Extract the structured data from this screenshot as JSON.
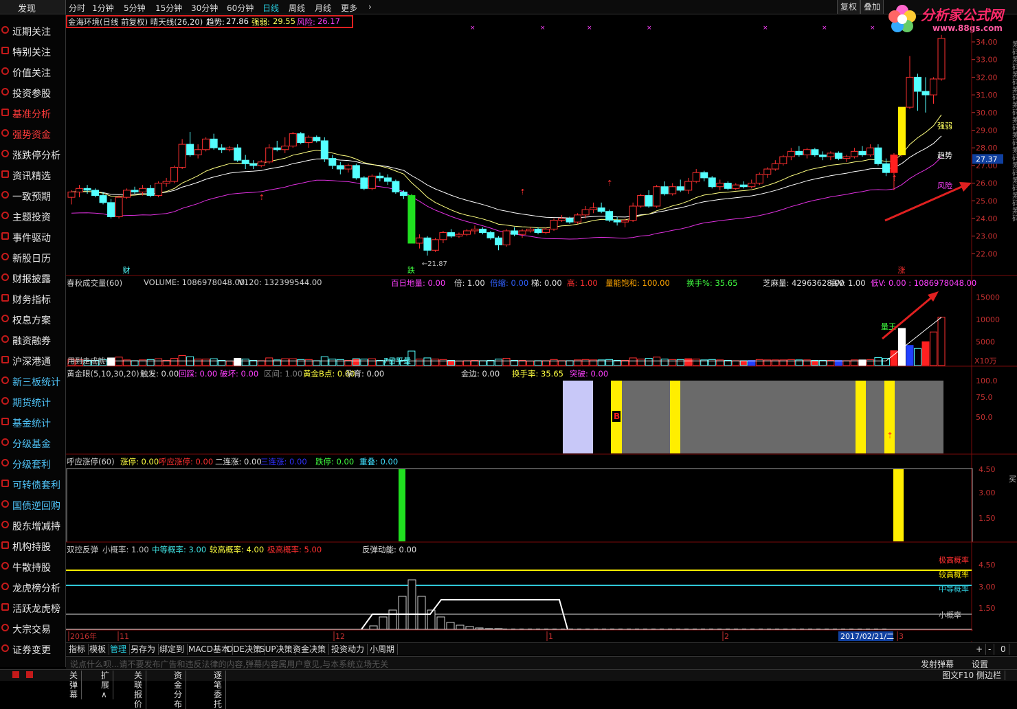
{
  "topbar": {
    "discover_label": "发现",
    "periods": [
      "分时",
      "1分钟",
      "5分钟",
      "15分钟",
      "30分钟",
      "60分钟",
      "日线",
      "周线",
      "月线",
      "更多"
    ],
    "active_period": "日线",
    "fuquan_label": "复权",
    "diejia_label": "叠加"
  },
  "logo": {
    "name": "分析家公式网",
    "url": "www.88gs.com"
  },
  "sidebar": {
    "items": [
      {
        "label": "近期关注",
        "color": "#e6e6e6"
      },
      {
        "label": "特别关注",
        "color": "#e6e6e6"
      },
      {
        "label": "价值关注",
        "color": "#e6e6e6"
      },
      {
        "label": "投资参股",
        "color": "#e6e6e6"
      },
      {
        "label": "基准分析",
        "color": "#ff3b3b"
      },
      {
        "label": "强势资金",
        "color": "#ff3b3b"
      },
      {
        "label": "涨跌停分析",
        "color": "#e6e6e6"
      },
      {
        "label": "资讯精选",
        "color": "#e6e6e6"
      },
      {
        "label": "一致预期",
        "color": "#e6e6e6"
      },
      {
        "label": "主题投资",
        "color": "#e6e6e6"
      },
      {
        "label": "事件驱动",
        "color": "#e6e6e6"
      },
      {
        "label": "新股日历",
        "color": "#e6e6e6"
      },
      {
        "label": "财报披露",
        "color": "#e6e6e6"
      },
      {
        "label": "财务指标",
        "color": "#e6e6e6"
      },
      {
        "label": "权息方案",
        "color": "#e6e6e6"
      },
      {
        "label": "融资融券",
        "color": "#e6e6e6"
      },
      {
        "label": "沪深港通",
        "color": "#e6e6e6"
      },
      {
        "label": "新三板统计",
        "color": "#4fc3f7"
      },
      {
        "label": "期货统计",
        "color": "#4fc3f7"
      },
      {
        "label": "基金统计",
        "color": "#4fc3f7"
      },
      {
        "label": "分级基金",
        "color": "#4fc3f7"
      },
      {
        "label": "分级套利",
        "color": "#4fc3f7"
      },
      {
        "label": "可转债套利",
        "color": "#4fc3f7"
      },
      {
        "label": "国债逆回购",
        "color": "#4fc3f7"
      },
      {
        "label": "股东增减持",
        "color": "#e6e6e6"
      },
      {
        "label": "机构持股",
        "color": "#e6e6e6"
      },
      {
        "label": "牛散持股",
        "color": "#e6e6e6"
      },
      {
        "label": "龙虎榜分析",
        "color": "#e6e6e6"
      },
      {
        "label": "活跃龙虎榜",
        "color": "#e6e6e6"
      },
      {
        "label": "大宗交易",
        "color": "#e6e6e6"
      },
      {
        "label": "证券变更",
        "color": "#e6e6e6"
      }
    ]
  },
  "main": {
    "header": {
      "name": "金海环境(日线 前复权) 晴天线(26,20)",
      "trend_label": "趋势:",
      "trend_value": "27.86",
      "strength_label": "强弱:",
      "strength_value": "29.55",
      "risk_label": "风险:",
      "risk_value": "26.17"
    },
    "price_axis": [
      "34.00",
      "33.00",
      "32.00",
      "31.00",
      "30.00",
      "29.00",
      "28.00",
      "27.00",
      "26.00",
      "25.00",
      "24.00",
      "23.00",
      "22.00"
    ],
    "current_price": "27.37",
    "low_label": "21.87",
    "line_labels": {
      "strength": "强弱",
      "trend": "趋势",
      "risk": "风险"
    },
    "marks": {
      "cai": "财",
      "die": "跌",
      "zhang": "涨"
    },
    "right_strip": "筹码筹码筹码筹码筹码筹码筹码筹码筹码筹码筹码筹码"
  },
  "volume": {
    "header_items": [
      {
        "text": "春秋成交量(60)",
        "color": "#d0d0d0"
      },
      {
        "text": "VOLUME: 1086978048.00",
        "color": "#d0d0d0"
      },
      {
        "text": "V120: 132399544.00",
        "color": "#d0d0d0"
      },
      {
        "text": "百日地量: 0.00",
        "color": "#ff40ff"
      },
      {
        "text": "倍: 1.00",
        "color": "#e0e0e0"
      },
      {
        "text": "倍缩: 0.00",
        "color": "#3060ff"
      },
      {
        "text": "梯: 0.00",
        "color": "#e0e0e0"
      },
      {
        "text": "高: 1.00",
        "color": "#ff3030"
      },
      {
        "text": "量能饱和: 100.00",
        "color": "#ffa500"
      },
      {
        "text": "换手%: 35.65",
        "color": "#40ff40"
      },
      {
        "text": "芝麻量: 42963628.00",
        "color": "#e0e0e0"
      },
      {
        "text": "高V: 1.00",
        "color": "#e0e0e0"
      },
      {
        "text": "低V: 0.00 : 1086978048.00",
        "color": "#ff40ff"
      }
    ],
    "axis": [
      "15000",
      "10000",
      "5000"
    ],
    "unit": "X10万",
    "labels": {
      "left": "用到走成就",
      "mid": "7日平量",
      "king": "量王"
    }
  },
  "golden": {
    "header_items": [
      {
        "text": "黄金眼(5,10,30,20)",
        "color": "#d0d0d0"
      },
      {
        "text": "触发: 0.00",
        "color": "#e0e0e0"
      },
      {
        "text": "回踩: 0.00",
        "color": "#ff40ff"
      },
      {
        "text": "破坏: 0.00",
        "color": "#ff40ff"
      },
      {
        "text": "区间: 1.00",
        "color": "#808080"
      },
      {
        "text": "黄金B点: 0.00",
        "color": "#ffff40"
      },
      {
        "text": "孕育: 0.00",
        "color": "#e0e0e0"
      },
      {
        "text": "金边: 0.00",
        "color": "#e0e0e0"
      },
      {
        "text": "换手率: 35.65",
        "color": "#ffff40"
      },
      {
        "text": "突破: 0.00",
        "color": "#ff40ff"
      }
    ],
    "axis": [
      "100.0",
      "75.0",
      "50.0"
    ],
    "b_mark": "B"
  },
  "limit": {
    "header_items": [
      {
        "text": "呼应涨停(60)",
        "color": "#d0d0d0"
      },
      {
        "text": "涨停: 0.00",
        "color": "#ffff40"
      },
      {
        "text": "呼应涨停: 0.00",
        "color": "#ff3030"
      },
      {
        "text": "二连涨: 0.00",
        "color": "#e0e0e0"
      },
      {
        "text": "三连涨: 0.00",
        "color": "#3030ff"
      },
      {
        "text": "跌停: 0.00",
        "color": "#40ff40"
      },
      {
        "text": "重叠: 0.00",
        "color": "#40e0ff"
      }
    ],
    "axis": [
      "4.50",
      "3.00",
      "1.50"
    ],
    "right_char": "买"
  },
  "rebound": {
    "header_items": [
      {
        "text": "双控反弹",
        "color": "#d0d0d0"
      },
      {
        "text": "小概率: 1.00",
        "color": "#c0c0c0"
      },
      {
        "text": "中等概率: 3.00",
        "color": "#40e0e0"
      },
      {
        "text": "较高概率: 4.00",
        "color": "#ffff40"
      },
      {
        "text": "极高概率: 5.00",
        "color": "#ff3030"
      },
      {
        "text": "反弹动能: 0.00",
        "color": "#e0e0e0"
      }
    ],
    "axis": [
      "4.50",
      "3.00",
      "1.50"
    ],
    "line_labels": {
      "extreme": "极高概率",
      "high": "较高概率",
      "mid": "中等概率",
      "low": "小概率"
    }
  },
  "time_axis": {
    "year": "2016年",
    "m11": "11",
    "m12": "12",
    "m1": "1",
    "m2": "2",
    "date": "2017/02/21/二",
    "m3": "3"
  },
  "tabs": [
    "指标",
    "模板",
    "管理",
    "另存为",
    "绑定到",
    "MACD基本",
    "DDE决策",
    "SUP决策",
    "资金决策",
    "投资动力",
    "小周期"
  ],
  "active_tab": "管理",
  "zoom_buttons": [
    "+",
    "-",
    "0"
  ],
  "danmu": {
    "placeholder": "说点什么呗...请不要发布广告和违反法律的内容,弹幕内容属用户意见,与本系统立场无关",
    "send": "发射弹幕",
    "settings": "设置"
  },
  "bottombar": {
    "items": [
      "关弹幕",
      "扩展∧",
      "关联报价",
      "资金分布",
      "逐笔委托"
    ],
    "right_a": "图文F10",
    "right_b": "侧边栏"
  },
  "chart_data": {
    "type": "candlestick",
    "title": "金海环境(日线 前复权)",
    "ylim": [
      21.5,
      34.5
    ],
    "candles": [
      [
        25.2,
        25.6,
        24.8,
        25.5
      ],
      [
        25.5,
        25.9,
        25.2,
        25.7
      ],
      [
        25.7,
        25.9,
        25.4,
        25.6
      ],
      [
        25.6,
        25.7,
        25.2,
        25.3
      ],
      [
        25.3,
        25.5,
        24.8,
        24.9
      ],
      [
        24.9,
        25.1,
        24.0,
        24.1
      ],
      [
        24.1,
        25.3,
        24.0,
        25.2
      ],
      [
        25.2,
        25.7,
        25.1,
        25.6
      ],
      [
        25.6,
        25.8,
        25.4,
        25.5
      ],
      [
        25.5,
        25.9,
        25.3,
        25.7
      ],
      [
        25.7,
        25.9,
        25.2,
        25.3
      ],
      [
        25.3,
        26.1,
        25.2,
        26.0
      ],
      [
        26.0,
        26.3,
        25.8,
        26.1
      ],
      [
        26.1,
        27.0,
        26.0,
        26.9
      ],
      [
        26.9,
        28.5,
        26.8,
        28.2
      ],
      [
        28.2,
        28.9,
        27.5,
        27.6
      ],
      [
        27.6,
        28.2,
        27.4,
        27.9
      ],
      [
        27.9,
        28.6,
        27.8,
        28.5
      ],
      [
        28.5,
        28.8,
        27.9,
        28.0
      ],
      [
        28.0,
        28.2,
        27.7,
        27.9
      ],
      [
        27.9,
        28.1,
        27.8,
        28.0
      ],
      [
        28.0,
        28.2,
        27.2,
        27.3
      ],
      [
        27.3,
        27.6,
        26.8,
        27.1
      ],
      [
        27.1,
        27.3,
        26.8,
        27.0
      ],
      [
        27.0,
        27.3,
        26.9,
        27.2
      ],
      [
        27.2,
        28.2,
        27.1,
        28.0
      ],
      [
        28.0,
        28.4,
        27.8,
        27.9
      ],
      [
        27.9,
        28.6,
        27.7,
        28.1
      ],
      [
        28.1,
        28.9,
        28.0,
        28.8
      ],
      [
        28.8,
        28.9,
        28.2,
        28.3
      ],
      [
        28.3,
        28.7,
        28.0,
        28.6
      ],
      [
        28.6,
        28.7,
        28.3,
        28.4
      ],
      [
        28.4,
        28.6,
        27.2,
        27.4
      ],
      [
        27.4,
        27.6,
        26.8,
        27.0
      ],
      [
        27.0,
        27.2,
        26.5,
        26.8
      ],
      [
        26.8,
        27.1,
        26.6,
        27.0
      ],
      [
        27.0,
        27.1,
        26.2,
        26.3
      ],
      [
        26.3,
        26.4,
        25.6,
        25.7
      ],
      [
        25.7,
        26.5,
        25.6,
        26.4
      ],
      [
        26.4,
        26.6,
        26.1,
        26.3
      ],
      [
        26.3,
        26.5,
        25.9,
        26.1
      ],
      [
        26.1,
        26.2,
        25.4,
        25.5
      ],
      [
        25.5,
        25.6,
        25.1,
        25.3
      ],
      [
        25.3,
        25.4,
        22.6,
        22.6
      ],
      [
        22.6,
        23.1,
        22.3,
        22.9
      ],
      [
        22.9,
        23.0,
        21.9,
        22.2
      ],
      [
        22.2,
        22.9,
        22.1,
        22.8
      ],
      [
        22.8,
        23.3,
        22.6,
        23.2
      ],
      [
        23.2,
        23.4,
        22.9,
        23.0
      ],
      [
        23.0,
        23.2,
        22.9,
        23.1
      ],
      [
        23.1,
        23.4,
        23.0,
        23.3
      ],
      [
        23.3,
        23.6,
        23.1,
        23.4
      ],
      [
        23.4,
        23.5,
        23.1,
        23.2
      ],
      [
        23.2,
        23.3,
        22.8,
        22.9
      ],
      [
        22.9,
        23.0,
        22.2,
        22.5
      ],
      [
        22.5,
        23.4,
        22.4,
        23.3
      ],
      [
        23.3,
        23.5,
        23.0,
        23.1
      ],
      [
        23.1,
        23.4,
        22.9,
        23.3
      ],
      [
        23.3,
        23.5,
        23.2,
        23.4
      ],
      [
        23.4,
        23.5,
        23.1,
        23.2
      ],
      [
        23.2,
        23.5,
        23.1,
        23.4
      ],
      [
        23.4,
        24.0,
        23.3,
        23.9
      ],
      [
        23.9,
        24.2,
        23.8,
        24.0
      ],
      [
        24.0,
        24.1,
        23.7,
        23.8
      ],
      [
        23.8,
        24.3,
        23.7,
        24.2
      ],
      [
        24.2,
        24.7,
        24.0,
        24.5
      ],
      [
        24.5,
        24.9,
        24.3,
        24.6
      ],
      [
        24.6,
        24.9,
        24.3,
        24.4
      ],
      [
        24.4,
        24.5,
        23.8,
        23.9
      ],
      [
        23.9,
        24.1,
        23.6,
        23.8
      ],
      [
        23.8,
        24.0,
        23.5,
        23.9
      ],
      [
        23.9,
        24.9,
        23.8,
        24.7
      ],
      [
        24.7,
        25.4,
        24.6,
        25.3
      ],
      [
        25.3,
        25.6,
        24.6,
        24.7
      ],
      [
        24.7,
        25.9,
        24.6,
        25.8
      ],
      [
        25.8,
        26.1,
        25.3,
        25.4
      ],
      [
        25.4,
        26.0,
        25.3,
        25.8
      ],
      [
        25.8,
        26.2,
        25.5,
        25.6
      ],
      [
        25.6,
        26.3,
        25.4,
        26.1
      ],
      [
        26.1,
        26.8,
        26.0,
        26.6
      ],
      [
        26.6,
        26.7,
        26.1,
        26.3
      ],
      [
        26.3,
        26.4,
        25.7,
        25.8
      ],
      [
        25.8,
        26.2,
        25.6,
        26.0
      ],
      [
        26.0,
        26.1,
        25.6,
        25.7
      ],
      [
        25.7,
        26.0,
        25.6,
        25.9
      ],
      [
        25.9,
        26.1,
        25.7,
        25.8
      ],
      [
        25.8,
        26.2,
        25.7,
        26.0
      ],
      [
        26.0,
        26.6,
        25.9,
        26.5
      ],
      [
        26.5,
        26.9,
        26.3,
        26.8
      ],
      [
        26.8,
        27.3,
        26.7,
        27.1
      ],
      [
        27.1,
        27.6,
        27.0,
        27.5
      ],
      [
        27.5,
        28.0,
        27.3,
        27.8
      ],
      [
        27.8,
        28.1,
        27.5,
        27.6
      ],
      [
        27.6,
        28.0,
        27.4,
        27.9
      ],
      [
        27.9,
        28.0,
        27.5,
        27.6
      ],
      [
        27.6,
        27.8,
        27.3,
        27.5
      ],
      [
        27.5,
        27.8,
        27.3,
        27.7
      ],
      [
        27.7,
        27.8,
        27.3,
        27.4
      ],
      [
        27.4,
        27.6,
        27.2,
        27.5
      ],
      [
        27.5,
        28.0,
        27.4,
        27.8
      ],
      [
        27.8,
        28.1,
        27.5,
        27.6
      ],
      [
        27.6,
        28.2,
        27.5,
        28.0
      ],
      [
        28.0,
        28.2,
        27.0,
        27.1
      ],
      [
        27.1,
        27.4,
        26.4,
        26.6
      ],
      [
        26.6,
        27.7,
        25.6,
        27.6
      ],
      [
        27.6,
        30.3,
        27.5,
        30.3
      ],
      [
        30.3,
        33.2,
        30.2,
        32.0
      ],
      [
        32.0,
        32.2,
        30.1,
        31.2
      ],
      [
        31.2,
        32.0,
        30.0,
        31.0
      ],
      [
        31.0,
        32.0,
        30.5,
        31.9
      ],
      [
        31.9,
        34.4,
        31.8,
        34.2
      ]
    ],
    "series": [
      {
        "name": "趋势",
        "color": "#ffffff"
      },
      {
        "name": "强弱",
        "color": "#ffff80"
      },
      {
        "name": "风险",
        "color": "#ff40ff"
      }
    ]
  }
}
